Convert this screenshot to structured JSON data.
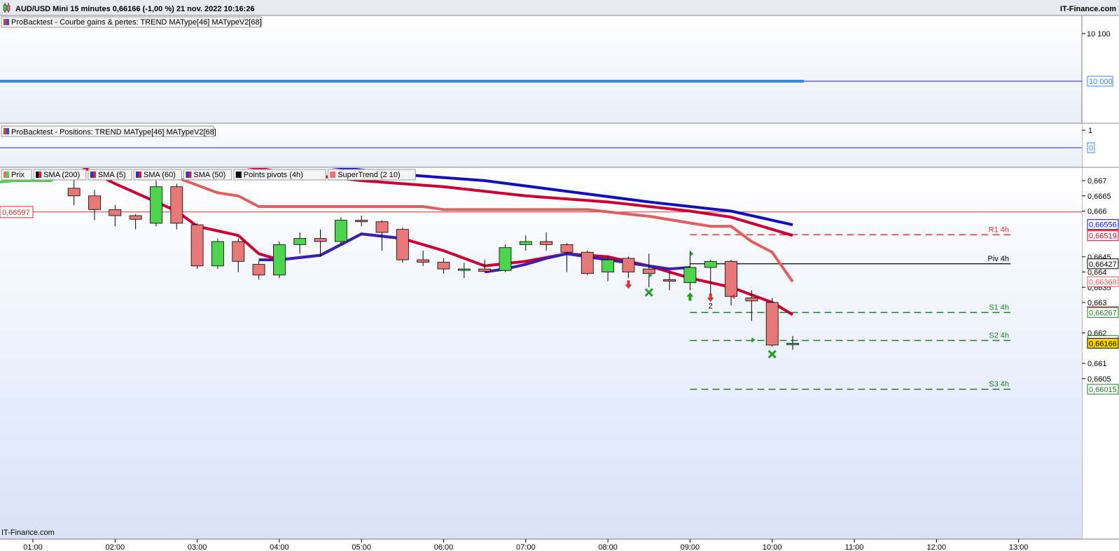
{
  "header": {
    "title": "AUD/USD Mini 15 minutes 0,66166 (-1,00 %) 21 nov. 2022 10:16:26",
    "brand": "IT-Finance.com"
  },
  "footer": {
    "watermark": "IT-Finance.com"
  },
  "panels": {
    "equity": {
      "label": "ProBacktest - Courbe gains & pertes: TREND MAType[46] MATypeV2[68]",
      "ticks": [
        "10 100"
      ],
      "value_badge": "10 000"
    },
    "positions": {
      "label": "ProBacktest - Positions: TREND MAType[46] MATypeV2[68]",
      "ticks": [
        "1"
      ],
      "value_badge": "0"
    },
    "price": {
      "legend": [
        {
          "label": "Prix",
          "color": "#e57373"
        },
        {
          "label": "SMA (200)",
          "color": "#000000"
        },
        {
          "label": "SMA (5)",
          "color": "#3030c0"
        },
        {
          "label": "SMA (60)",
          "color": "#3030c0"
        },
        {
          "label": "SMA (50)",
          "color": "#3030c0"
        },
        {
          "label": "Points pivots (4h)",
          "color": "#000000"
        },
        {
          "label": "SuperTrend (2 10)",
          "color": "#e57373"
        }
      ],
      "left_badge": "0,66597"
    }
  },
  "colors": {
    "up": "#4cd44c",
    "down": "#e87878",
    "sma5": "#cc0033",
    "sma50": "#1010bb",
    "sma60": "#cc0033",
    "supertrend_up": "#55cc55",
    "supertrend_down": "#e06060",
    "panel_bg_top": "#ffffff",
    "panel_bg_bottom": "#dce6f8"
  },
  "chart_data": {
    "type": "candlestick",
    "instrument": "AUD/USD Mini",
    "timeframe": "15 minutes",
    "x_labels": [
      "01:00",
      "02:00",
      "03:00",
      "04:00",
      "05:00",
      "06:00",
      "07:00",
      "08:00",
      "09:00",
      "10:00",
      "11:00",
      "12:00",
      "13:00"
    ],
    "y_ticks": [
      "0,667",
      "0,6665",
      "0,666",
      "0,6645",
      "0,664",
      "0,6635",
      "0,663",
      "0,662",
      "0,661",
      "0,6605"
    ],
    "ylim": [
      0.66,
      0.6672
    ],
    "candles": [
      {
        "t": "01:30",
        "o": 0.66675,
        "h": 0.6672,
        "l": 0.6662,
        "c": 0.6665
      },
      {
        "t": "01:45",
        "o": 0.6665,
        "h": 0.6667,
        "l": 0.6657,
        "c": 0.66605
      },
      {
        "t": "02:00",
        "o": 0.66605,
        "h": 0.6662,
        "l": 0.6655,
        "c": 0.66585
      },
      {
        "t": "02:15",
        "o": 0.66585,
        "h": 0.6659,
        "l": 0.6654,
        "c": 0.66573
      },
      {
        "t": "02:30",
        "o": 0.6656,
        "h": 0.667,
        "l": 0.6655,
        "c": 0.6668
      },
      {
        "t": "02:45",
        "o": 0.6668,
        "h": 0.6669,
        "l": 0.6654,
        "c": 0.6656
      },
      {
        "t": "03:00",
        "o": 0.66555,
        "h": 0.6656,
        "l": 0.6641,
        "c": 0.6642
      },
      {
        "t": "03:15",
        "o": 0.6642,
        "h": 0.6651,
        "l": 0.6641,
        "c": 0.665
      },
      {
        "t": "03:30",
        "o": 0.665,
        "h": 0.6651,
        "l": 0.664,
        "c": 0.66435
      },
      {
        "t": "03:45",
        "o": 0.66425,
        "h": 0.66435,
        "l": 0.66375,
        "c": 0.6639
      },
      {
        "t": "04:00",
        "o": 0.6639,
        "h": 0.665,
        "l": 0.6638,
        "c": 0.6649
      },
      {
        "t": "04:15",
        "o": 0.6649,
        "h": 0.6653,
        "l": 0.6646,
        "c": 0.6651
      },
      {
        "t": "04:30",
        "o": 0.6651,
        "h": 0.6654,
        "l": 0.6645,
        "c": 0.665
      },
      {
        "t": "04:45",
        "o": 0.665,
        "h": 0.6658,
        "l": 0.6649,
        "c": 0.6657
      },
      {
        "t": "05:00",
        "o": 0.6657,
        "h": 0.66585,
        "l": 0.6655,
        "c": 0.66565
      },
      {
        "t": "05:15",
        "o": 0.66565,
        "h": 0.6657,
        "l": 0.6647,
        "c": 0.6653
      },
      {
        "t": "05:30",
        "o": 0.6654,
        "h": 0.66545,
        "l": 0.6643,
        "c": 0.6644
      },
      {
        "t": "05:45",
        "o": 0.6644,
        "h": 0.6647,
        "l": 0.6642,
        "c": 0.66432
      },
      {
        "t": "06:00",
        "o": 0.66432,
        "h": 0.66445,
        "l": 0.66395,
        "c": 0.6641
      },
      {
        "t": "06:15",
        "o": 0.6641,
        "h": 0.6643,
        "l": 0.6638,
        "c": 0.6641
      },
      {
        "t": "06:30",
        "o": 0.6641,
        "h": 0.6644,
        "l": 0.664,
        "c": 0.66402
      },
      {
        "t": "06:45",
        "o": 0.66405,
        "h": 0.6649,
        "l": 0.664,
        "c": 0.6648
      },
      {
        "t": "07:00",
        "o": 0.6649,
        "h": 0.6652,
        "l": 0.6647,
        "c": 0.665
      },
      {
        "t": "07:15",
        "o": 0.665,
        "h": 0.6653,
        "l": 0.6647,
        "c": 0.6649
      },
      {
        "t": "07:30",
        "o": 0.6649,
        "h": 0.66495,
        "l": 0.664,
        "c": 0.66465
      },
      {
        "t": "07:45",
        "o": 0.66465,
        "h": 0.6647,
        "l": 0.6639,
        "c": 0.66395
      },
      {
        "t": "08:00",
        "o": 0.664,
        "h": 0.66455,
        "l": 0.6637,
        "c": 0.6644
      },
      {
        "t": "08:15",
        "o": 0.66445,
        "h": 0.6645,
        "l": 0.6638,
        "c": 0.664
      },
      {
        "t": "08:30",
        "o": 0.6641,
        "h": 0.6646,
        "l": 0.6635,
        "c": 0.66395
      },
      {
        "t": "08:45",
        "o": 0.66375,
        "h": 0.664,
        "l": 0.6634,
        "c": 0.6637
      },
      {
        "t": "09:00",
        "o": 0.66365,
        "h": 0.6647,
        "l": 0.6634,
        "c": 0.66415
      },
      {
        "t": "09:15",
        "o": 0.66415,
        "h": 0.6644,
        "l": 0.6632,
        "c": 0.66435
      },
      {
        "t": "09:30",
        "o": 0.66435,
        "h": 0.6644,
        "l": 0.6629,
        "c": 0.6632
      },
      {
        "t": "09:45",
        "o": 0.66315,
        "h": 0.6634,
        "l": 0.6624,
        "c": 0.66305
      },
      {
        "t": "10:00",
        "o": 0.663,
        "h": 0.66315,
        "l": 0.66155,
        "c": 0.6616
      },
      {
        "t": "10:15",
        "o": 0.66166,
        "h": 0.6619,
        "l": 0.66145,
        "c": 0.66166
      }
    ],
    "series": [
      {
        "name": "SMA (5)",
        "color": "#cc0033",
        "points": [
          [
            "01:30",
            0.6676
          ],
          [
            "02:00",
            0.6669
          ],
          [
            "02:45",
            0.666
          ],
          [
            "03:00",
            0.6655
          ],
          [
            "03:30",
            0.6652
          ],
          [
            "03:45",
            0.6646
          ],
          [
            "04:00",
            0.6644
          ],
          [
            "04:30",
            0.66455
          ],
          [
            "05:00",
            0.66525
          ],
          [
            "05:30",
            0.6651
          ],
          [
            "06:00",
            0.6647
          ],
          [
            "06:30",
            0.6642
          ],
          [
            "07:00",
            0.66435
          ],
          [
            "07:30",
            0.6646
          ],
          [
            "08:00",
            0.6645
          ],
          [
            "08:30",
            0.6642
          ],
          [
            "09:00",
            0.6638
          ],
          [
            "09:30",
            0.6635
          ],
          [
            "10:00",
            0.663
          ],
          [
            "10:15",
            0.6626
          ]
        ]
      },
      {
        "name": "SMA (50)",
        "color": "#1010bb",
        "points": [
          [
            "04:30",
            0.6675
          ],
          [
            "05:30",
            0.6672
          ],
          [
            "06:30",
            0.667
          ],
          [
            "07:30",
            0.66665
          ],
          [
            "08:30",
            0.6663
          ],
          [
            "09:30",
            0.666
          ],
          [
            "10:15",
            0.66555
          ]
        ]
      },
      {
        "name": "SMA (60)",
        "color": "#cc0033",
        "points": [
          [
            "03:00",
            0.6677
          ],
          [
            "04:00",
            0.6673
          ],
          [
            "05:00",
            0.667
          ],
          [
            "06:00",
            0.6668
          ],
          [
            "07:00",
            0.6665
          ],
          [
            "08:00",
            0.6663
          ],
          [
            "09:00",
            0.666
          ],
          [
            "09:30",
            0.6658
          ],
          [
            "10:15",
            0.6652
          ]
        ]
      },
      {
        "name": "SuperTrend (2 10)",
        "color": "#e06060",
        "points": [
          [
            "02:30",
            0.6672
          ],
          [
            "02:45",
            0.6671
          ],
          [
            "03:00",
            0.66685
          ],
          [
            "03:15",
            0.6666
          ],
          [
            "03:30",
            0.6665
          ],
          [
            "03:45",
            0.66615
          ],
          [
            "05:45",
            0.66615
          ],
          [
            "06:00",
            0.66605
          ],
          [
            "07:45",
            0.66605
          ],
          [
            "08:15",
            0.6659
          ],
          [
            "08:30",
            0.66583
          ],
          [
            "09:15",
            0.6655
          ],
          [
            "09:30",
            0.6655
          ],
          [
            "09:45",
            0.665
          ],
          [
            "10:00",
            0.66465
          ],
          [
            "10:15",
            0.66368
          ]
        ]
      }
    ],
    "pivots": [
      {
        "label": "R1 4h",
        "value": 0.66522,
        "color": "#e03030",
        "dash": true
      },
      {
        "label": "Piv 4h",
        "value": 0.66427,
        "color": "#000000",
        "dash": false
      },
      {
        "label": "S1 4h",
        "value": 0.66267,
        "color": "#208020",
        "dash": true
      },
      {
        "label": "S2 4h",
        "value": 0.66175,
        "color": "#208020",
        "dash": true
      },
      {
        "label": "S3 4h",
        "value": 0.66015,
        "color": "#208020",
        "dash": true
      }
    ],
    "hline": {
      "value": 0.66597,
      "color": "#e03030"
    },
    "price_badges": [
      {
        "text": "0,66556",
        "value": 0.66556,
        "color": "#1010bb",
        "fill": "#ffffff"
      },
      {
        "text": "0,66522",
        "value": 0.66522,
        "color": "#e03030",
        "fill": "#ffffff"
      },
      {
        "text": "0,66519",
        "value": 0.66519,
        "color": "#cc0033",
        "fill": "#ffffff"
      },
      {
        "text": "0,66427",
        "value": 0.66427,
        "color": "#000000",
        "fill": "#ffffff"
      },
      {
        "text": "0,66368",
        "value": 0.66368,
        "color": "#e06060",
        "fill": "#ffffff"
      },
      {
        "text": "0,66270",
        "value": 0.6627,
        "color": "#cc0033",
        "fill": "#ffffff"
      },
      {
        "text": "0,66267",
        "value": 0.66267,
        "color": "#208020",
        "fill": "#ffffff"
      },
      {
        "text": "0,66175",
        "value": 0.66175,
        "color": "#208020",
        "fill": "#ffffff"
      },
      {
        "text": "0,66166",
        "value": 0.66166,
        "color": "#000000",
        "fill": "#ffd700"
      },
      {
        "text": "0,66015",
        "value": 0.66015,
        "color": "#208020",
        "fill": "#ffffff"
      }
    ],
    "markers": [
      {
        "t": "08:15",
        "kind": "down-arrow",
        "color": "#e03030",
        "value": 0.66345
      },
      {
        "t": "08:30",
        "kind": "cross",
        "color": "#20a020",
        "value": 0.66333
      },
      {
        "t": "08:30",
        "kind": "tri-right",
        "color": "#20a020",
        "value": 0.6639
      },
      {
        "t": "09:00",
        "kind": "up-arrow",
        "color": "#20a020",
        "value": 0.66333
      },
      {
        "t": "09:00",
        "kind": "tri-right",
        "color": "#20a020",
        "value": 0.6646
      },
      {
        "t": "09:15",
        "kind": "down-arrow",
        "color": "#e03030",
        "value": 0.66302
      },
      {
        "t": "09:15",
        "kind": "text",
        "text": "2",
        "color": "#000000",
        "value": 0.6628
      },
      {
        "t": "09:30",
        "kind": "tri-left",
        "color": "#e03030",
        "value": 0.6632
      },
      {
        "t": "10:00",
        "kind": "cross",
        "color": "#20a020",
        "value": 0.6613
      },
      {
        "t": "09:45",
        "kind": "tri-right",
        "color": "#20a020",
        "value": 0.66177
      }
    ],
    "supertrend_up": [
      [
        "00:00",
        0.66695
      ],
      [
        "00:15",
        0.667
      ],
      [
        "00:30",
        0.667
      ],
      [
        "00:45",
        0.667
      ],
      [
        "01:15",
        0.667
      ]
    ]
  }
}
